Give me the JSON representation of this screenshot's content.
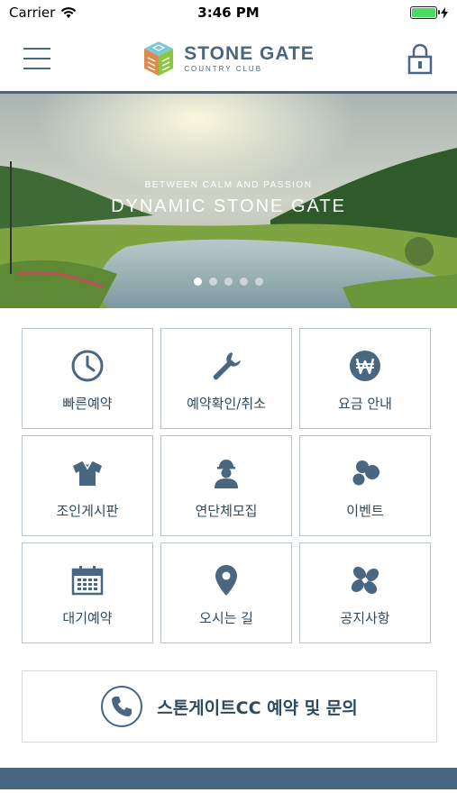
{
  "status_bar": {
    "carrier": "Carrier",
    "time": "3:46 PM",
    "battery_level": 1.0
  },
  "header": {
    "logo_title": "STONE GATE",
    "logo_subtitle": "COUNTRY CLUB"
  },
  "hero": {
    "subtitle": "BETWEEN CALM AND PASSION",
    "title": "DYNAMIC STONE GATE",
    "slide_count": 5,
    "active_slide": 1
  },
  "menu": {
    "items": [
      {
        "label": "빠른예약",
        "icon": "clock-icon"
      },
      {
        "label": "예약확인/취소",
        "icon": "wrench-icon"
      },
      {
        "label": "요금 안내",
        "icon": "won-icon"
      },
      {
        "label": "조인게시판",
        "icon": "shirt-icon"
      },
      {
        "label": "연단체모집",
        "icon": "person-icon"
      },
      {
        "label": "이벤트",
        "icon": "circles-icon"
      },
      {
        "label": "대기예약",
        "icon": "calendar-icon"
      },
      {
        "label": "오시는 길",
        "icon": "map-pin-icon"
      },
      {
        "label": "공지사항",
        "icon": "pinwheel-icon"
      }
    ]
  },
  "contact": {
    "label": "스톤게이트CC 예약 및 문의",
    "icon": "phone-icon"
  },
  "colors": {
    "primary": "#4a6781",
    "text": "#2f4a5e",
    "tile_border": "#b8c4ce"
  }
}
